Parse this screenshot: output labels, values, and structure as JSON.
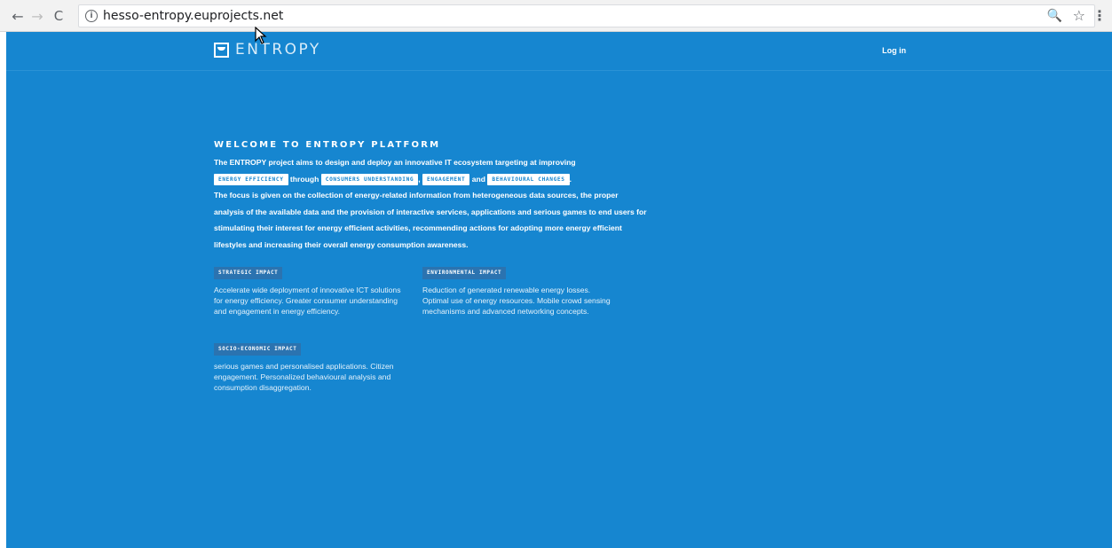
{
  "browser": {
    "url": "hesso-entropy.euprojects.net",
    "back_icon": "←",
    "forward_icon": "→",
    "reload_icon": "C",
    "info_icon": "i",
    "zoom_icon": "🔍",
    "star_icon": "☆",
    "menu_icon": "⋮"
  },
  "header": {
    "logo_text": "ENTROPY",
    "login_label": "Log in"
  },
  "welcome": {
    "title": "WELCOME TO ENTROPY PLATFORM",
    "intro_1": "The ENTROPY project aims to design and deploy an innovative IT ecosystem targeting at improving",
    "chip_1": "ENERGY EFFICIENCY",
    "word_through": "through",
    "chip_2": "CONSUMERS UNDERSTANDING",
    "comma": ",",
    "chip_3": "ENGAGEMENT",
    "word_and": "and",
    "chip_4": "BEHAVIOURAL CHANGES",
    "period": ".",
    "intro_2": "The focus is given on the collection of energy-related information from heterogeneous data sources, the proper analysis of the available data and the provision of interactive services, applications and serious games to end users for stimulating their interest for energy efficient activities, recommending actions for adopting more energy efficient lifestyles and increasing their overall energy consumption awareness."
  },
  "impacts": {
    "strategic": {
      "tag": "STRATEGIC IMPACT",
      "text": "Accelerate wide deployment of innovative ICT solutions for energy efficiency. Greater consumer understanding and engagement in energy efficiency."
    },
    "environmental": {
      "tag": "ENVIRONMENTAL IMPACT",
      "text": "Reduction of generated renewable energy losses. Optimal use of energy resources. Mobile crowd sensing mechanisms and advanced networking concepts."
    },
    "socio": {
      "tag": "SOCIO-ECONOMIC IMPACT",
      "text": "serious games and personalised applications. Citizen engagement. Personalized behavioural analysis and consumption disaggregation."
    }
  },
  "colors": {
    "page_background": "#1686d0",
    "chip_background": "#ffffff",
    "impact_tag_background": "#2b73b0"
  }
}
